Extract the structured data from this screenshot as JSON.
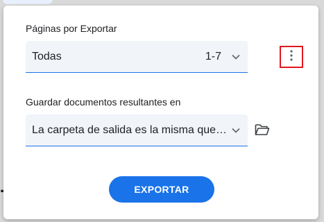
{
  "dialog": {
    "pages_label": "Páginas por Exportar",
    "pages_select": {
      "value": "Todas",
      "range": "1-7"
    },
    "save_label": "Guardar documentos resultantes en",
    "save_select": {
      "value": "La carpeta de salida es la misma que la del documento original"
    },
    "export_button": "EXPORTAR"
  },
  "icons": {
    "chevron": "chevron-down-icon",
    "more": "more-vert-icon",
    "folder": "folder-open-icon"
  },
  "colors": {
    "accent": "#1a73e8",
    "highlight": "#e3161f",
    "field_bg": "#f1f4f9"
  }
}
